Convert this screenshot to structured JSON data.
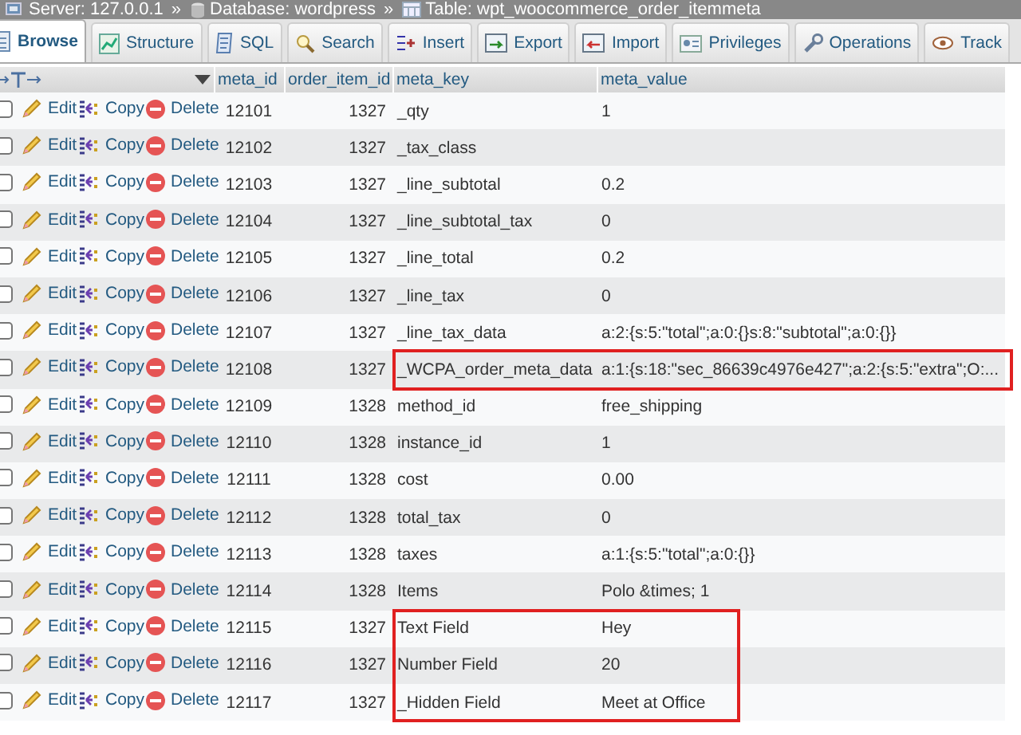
{
  "breadcrumb": [
    {
      "text": "Server: 127.0.0.1",
      "separator": "»"
    },
    {
      "text": "Database: wordpress",
      "separator": "»"
    },
    {
      "text": "Table: wpt_woocommerce_order_itemmeta"
    }
  ],
  "tabs": [
    {
      "label": "Browse",
      "selected": true
    },
    {
      "label": "Structure",
      "selected": false
    },
    {
      "label": "SQL",
      "selected": false
    },
    {
      "label": "Search",
      "selected": false
    },
    {
      "label": "Insert",
      "selected": false
    },
    {
      "label": "Export",
      "selected": false
    },
    {
      "label": "Import",
      "selected": false
    },
    {
      "label": "Privileges",
      "selected": false
    },
    {
      "label": "Operations",
      "selected": false
    },
    {
      "label": "Track",
      "selected": false
    }
  ],
  "table": {
    "columns": [
      "meta_id",
      "order_item_id",
      "meta_key",
      "meta_value"
    ],
    "rows": [
      {
        "checked": false,
        "edit": "Edit",
        "copy": "Copy",
        "delete": "Delete",
        "meta_id": "12101",
        "order_item_id": "1327",
        "meta_key": "_qty",
        "meta_value": "1",
        "highlighted": false
      },
      {
        "checked": false,
        "edit": "Edit",
        "copy": "Copy",
        "delete": "Delete",
        "meta_id": "12102",
        "order_item_id": "1327",
        "meta_key": "_tax_class",
        "highlighted": false
      },
      {
        "checked": false,
        "edit": "Edit",
        "copy": "Copy",
        "delete": "Delete",
        "meta_id": "12103",
        "order_item_id": "1327",
        "meta_key": "_line_subtotal",
        "meta_value": "0.2",
        "highlighted": false
      },
      {
        "checked": false,
        "edit": "Edit",
        "copy": "Copy",
        "delete": "Delete",
        "meta_id": "12104",
        "order_item_id": "1327",
        "meta_key": "_line_subtotal_tax",
        "meta_value": "0",
        "highlighted": false
      },
      {
        "checked": false,
        "edit": "Edit",
        "copy": "Copy",
        "delete": "Delete",
        "meta_id": "12105",
        "order_item_id": "1327",
        "meta_key": "_line_total",
        "meta_value": "0.2",
        "highlighted": false
      },
      {
        "checked": false,
        "edit": "Edit",
        "copy": "Copy",
        "delete": "Delete",
        "meta_id": "12106",
        "order_item_id": "1327",
        "meta_key": "_line_tax",
        "meta_value": "0",
        "highlighted": false
      },
      {
        "checked": false,
        "edit": "Edit",
        "copy": "Copy",
        "delete": "Delete",
        "meta_id": "12107",
        "order_item_id": "1327",
        "meta_key": "_line_tax_data",
        "meta_value": "a:2:{s:5:\"total\";a:0:{}s:8:\"subtotal\";a:0:{}}",
        "highlighted": false
      },
      {
        "checked": false,
        "edit": "Edit",
        "copy": "Copy",
        "delete": "Delete",
        "meta_id": "12108",
        "order_item_id": "1327",
        "meta_key": "_WCPA_order_meta_data",
        "meta_value": "a:1:{s:18:\"sec_86639c4976e427\";a:2:{s:5:\"extra\";O:...",
        "highlighted": true
      },
      {
        "checked": false,
        "edit": "Edit",
        "copy": "Copy",
        "delete": "Delete",
        "meta_id": "12109",
        "order_item_id": "1328",
        "meta_key": "method_id",
        "meta_value": "free_shipping",
        "highlighted": false
      },
      {
        "checked": false,
        "edit": "Edit",
        "copy": "Copy",
        "delete": "Delete",
        "meta_id": "12110",
        "order_item_id": "1328",
        "meta_key": "instance_id",
        "meta_value": "1",
        "highlighted": false
      },
      {
        "checked": false,
        "edit": "Edit",
        "copy": "Copy",
        "delete": "Delete",
        "meta_id": "12111",
        "order_item_id": "1328",
        "meta_key": "cost",
        "meta_value": "0.00",
        "highlighted": false
      },
      {
        "checked": false,
        "edit": "Edit",
        "copy": "Copy",
        "delete": "Delete",
        "meta_id": "12112",
        "order_item_id": "1328",
        "meta_key": "total_tax",
        "meta_value": "0",
        "highlighted": false
      },
      {
        "checked": false,
        "edit": "Edit",
        "copy": "Copy",
        "delete": "Delete",
        "meta_id": "12113",
        "order_item_id": "1328",
        "meta_key": "taxes",
        "meta_value": "a:1:{s:5:\"total\";a:0:{}}",
        "highlighted": false
      },
      {
        "checked": false,
        "edit": "Edit",
        "copy": "Copy",
        "delete": "Delete",
        "meta_id": "12114",
        "order_item_id": "1328",
        "meta_key": "Items",
        "meta_value": "Polo &times; 1",
        "highlighted": false
      },
      {
        "checked": false,
        "edit": "Edit",
        "copy": "Copy",
        "delete": "Delete",
        "meta_id": "12115",
        "order_item_id": "1327",
        "meta_key": "Text Field",
        "meta_value": "Hey",
        "highlighted": true
      },
      {
        "checked": false,
        "edit": "Edit",
        "copy": "Copy",
        "delete": "Delete",
        "meta_id": "12116",
        "order_item_id": "1327",
        "meta_key": "Number Field",
        "meta_value": "20",
        "highlighted": true
      },
      {
        "checked": false,
        "edit": "Edit",
        "copy": "Copy",
        "delete": "Delete",
        "meta_id": "12117",
        "order_item_id": "1327",
        "meta_key": "_Hidden Field",
        "meta_value": "Meet at Office",
        "highlighted": true
      }
    ]
  }
}
